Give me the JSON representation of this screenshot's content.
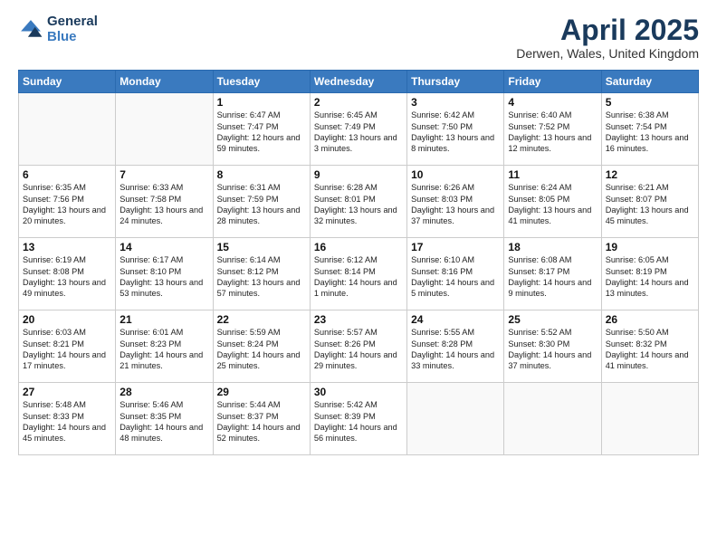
{
  "header": {
    "logo_line1": "General",
    "logo_line2": "Blue",
    "title": "April 2025",
    "subtitle": "Derwen, Wales, United Kingdom"
  },
  "calendar": {
    "days_of_week": [
      "Sunday",
      "Monday",
      "Tuesday",
      "Wednesday",
      "Thursday",
      "Friday",
      "Saturday"
    ],
    "weeks": [
      [
        {
          "day": "",
          "info": ""
        },
        {
          "day": "",
          "info": ""
        },
        {
          "day": "1",
          "info": "Sunrise: 6:47 AM\nSunset: 7:47 PM\nDaylight: 12 hours and 59 minutes."
        },
        {
          "day": "2",
          "info": "Sunrise: 6:45 AM\nSunset: 7:49 PM\nDaylight: 13 hours and 3 minutes."
        },
        {
          "day": "3",
          "info": "Sunrise: 6:42 AM\nSunset: 7:50 PM\nDaylight: 13 hours and 8 minutes."
        },
        {
          "day": "4",
          "info": "Sunrise: 6:40 AM\nSunset: 7:52 PM\nDaylight: 13 hours and 12 minutes."
        },
        {
          "day": "5",
          "info": "Sunrise: 6:38 AM\nSunset: 7:54 PM\nDaylight: 13 hours and 16 minutes."
        }
      ],
      [
        {
          "day": "6",
          "info": "Sunrise: 6:35 AM\nSunset: 7:56 PM\nDaylight: 13 hours and 20 minutes."
        },
        {
          "day": "7",
          "info": "Sunrise: 6:33 AM\nSunset: 7:58 PM\nDaylight: 13 hours and 24 minutes."
        },
        {
          "day": "8",
          "info": "Sunrise: 6:31 AM\nSunset: 7:59 PM\nDaylight: 13 hours and 28 minutes."
        },
        {
          "day": "9",
          "info": "Sunrise: 6:28 AM\nSunset: 8:01 PM\nDaylight: 13 hours and 32 minutes."
        },
        {
          "day": "10",
          "info": "Sunrise: 6:26 AM\nSunset: 8:03 PM\nDaylight: 13 hours and 37 minutes."
        },
        {
          "day": "11",
          "info": "Sunrise: 6:24 AM\nSunset: 8:05 PM\nDaylight: 13 hours and 41 minutes."
        },
        {
          "day": "12",
          "info": "Sunrise: 6:21 AM\nSunset: 8:07 PM\nDaylight: 13 hours and 45 minutes."
        }
      ],
      [
        {
          "day": "13",
          "info": "Sunrise: 6:19 AM\nSunset: 8:08 PM\nDaylight: 13 hours and 49 minutes."
        },
        {
          "day": "14",
          "info": "Sunrise: 6:17 AM\nSunset: 8:10 PM\nDaylight: 13 hours and 53 minutes."
        },
        {
          "day": "15",
          "info": "Sunrise: 6:14 AM\nSunset: 8:12 PM\nDaylight: 13 hours and 57 minutes."
        },
        {
          "day": "16",
          "info": "Sunrise: 6:12 AM\nSunset: 8:14 PM\nDaylight: 14 hours and 1 minute."
        },
        {
          "day": "17",
          "info": "Sunrise: 6:10 AM\nSunset: 8:16 PM\nDaylight: 14 hours and 5 minutes."
        },
        {
          "day": "18",
          "info": "Sunrise: 6:08 AM\nSunset: 8:17 PM\nDaylight: 14 hours and 9 minutes."
        },
        {
          "day": "19",
          "info": "Sunrise: 6:05 AM\nSunset: 8:19 PM\nDaylight: 14 hours and 13 minutes."
        }
      ],
      [
        {
          "day": "20",
          "info": "Sunrise: 6:03 AM\nSunset: 8:21 PM\nDaylight: 14 hours and 17 minutes."
        },
        {
          "day": "21",
          "info": "Sunrise: 6:01 AM\nSunset: 8:23 PM\nDaylight: 14 hours and 21 minutes."
        },
        {
          "day": "22",
          "info": "Sunrise: 5:59 AM\nSunset: 8:24 PM\nDaylight: 14 hours and 25 minutes."
        },
        {
          "day": "23",
          "info": "Sunrise: 5:57 AM\nSunset: 8:26 PM\nDaylight: 14 hours and 29 minutes."
        },
        {
          "day": "24",
          "info": "Sunrise: 5:55 AM\nSunset: 8:28 PM\nDaylight: 14 hours and 33 minutes."
        },
        {
          "day": "25",
          "info": "Sunrise: 5:52 AM\nSunset: 8:30 PM\nDaylight: 14 hours and 37 minutes."
        },
        {
          "day": "26",
          "info": "Sunrise: 5:50 AM\nSunset: 8:32 PM\nDaylight: 14 hours and 41 minutes."
        }
      ],
      [
        {
          "day": "27",
          "info": "Sunrise: 5:48 AM\nSunset: 8:33 PM\nDaylight: 14 hours and 45 minutes."
        },
        {
          "day": "28",
          "info": "Sunrise: 5:46 AM\nSunset: 8:35 PM\nDaylight: 14 hours and 48 minutes."
        },
        {
          "day": "29",
          "info": "Sunrise: 5:44 AM\nSunset: 8:37 PM\nDaylight: 14 hours and 52 minutes."
        },
        {
          "day": "30",
          "info": "Sunrise: 5:42 AM\nSunset: 8:39 PM\nDaylight: 14 hours and 56 minutes."
        },
        {
          "day": "",
          "info": ""
        },
        {
          "day": "",
          "info": ""
        },
        {
          "day": "",
          "info": ""
        }
      ]
    ]
  }
}
